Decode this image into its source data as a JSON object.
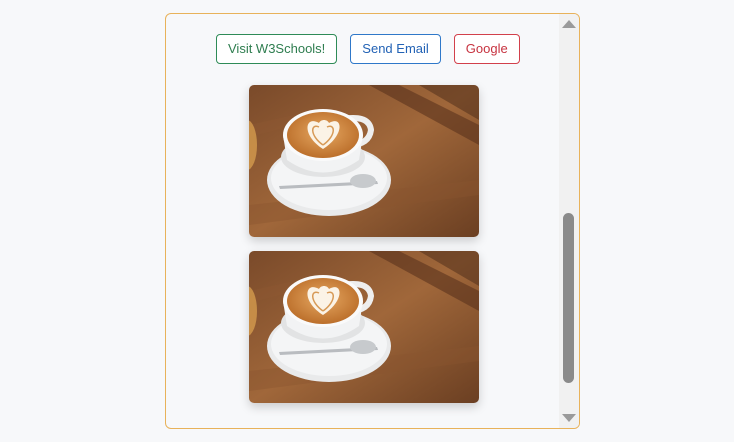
{
  "buttons": {
    "visit_label": "Visit W3Schools!",
    "email_label": "Send Email",
    "google_label": "Google"
  },
  "images": [
    {
      "icon": "coffee-latte-photo"
    },
    {
      "icon": "coffee-latte-photo"
    }
  ],
  "colors": {
    "panel_border": "#e8b25a",
    "green": "#2e8b57",
    "blue": "#2f78c9",
    "red": "#d2404b"
  }
}
